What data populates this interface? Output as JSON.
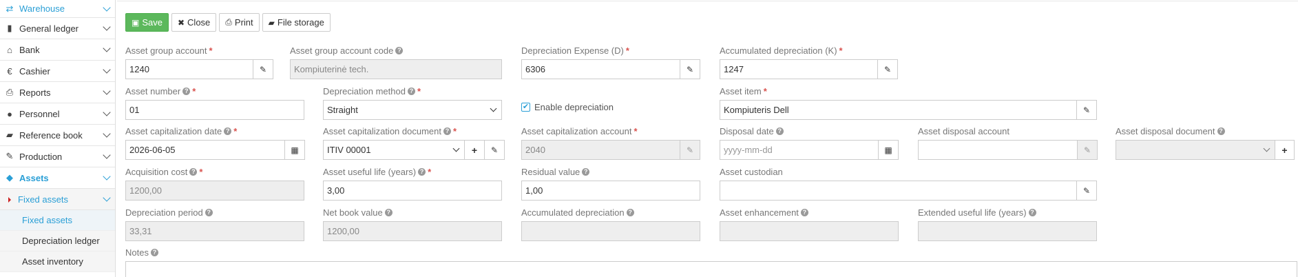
{
  "sidebar": {
    "items": [
      {
        "label": "Warehouse",
        "icon": "arrows-swap-icon"
      },
      {
        "label": "General ledger",
        "icon": "book-icon"
      },
      {
        "label": "Bank",
        "icon": "bank-icon"
      },
      {
        "label": "Cashier",
        "icon": "euro-icon"
      },
      {
        "label": "Reports",
        "icon": "printer-icon"
      },
      {
        "label": "Personnel",
        "icon": "users-icon"
      },
      {
        "label": "Reference book",
        "icon": "folder-open-icon"
      },
      {
        "label": "Production",
        "icon": "wrench-icon"
      },
      {
        "label": "Assets",
        "icon": "cube-icon"
      }
    ],
    "submenu": {
      "label": "Fixed assets"
    },
    "leaves": [
      {
        "label": "Fixed assets"
      },
      {
        "label": "Depreciation ledger"
      },
      {
        "label": "Asset inventory"
      }
    ]
  },
  "toolbar": {
    "save_label": "Save",
    "close_label": "Close",
    "print_label": "Print",
    "file_storage_label": "File storage"
  },
  "form": {
    "asset_group_account": {
      "label": "Asset group account",
      "value": "1240"
    },
    "asset_group_account_code": {
      "label": "Asset group account code",
      "value": "Kompiuterinė tech."
    },
    "depreciation_expense": {
      "label": "Depreciation Expense (D)",
      "value": "6306"
    },
    "accumulated_depreciation_k": {
      "label": "Accumulated depreciation (K)",
      "value": "1247"
    },
    "asset_number": {
      "label": "Asset number",
      "value": "01"
    },
    "depreciation_method": {
      "label": "Depreciation method",
      "value": "Straight"
    },
    "enable_depreciation": {
      "label": "Enable depreciation",
      "checked": true
    },
    "asset_item": {
      "label": "Asset item",
      "value": "Kompiuteris Dell"
    },
    "capitalization_date": {
      "label": "Asset capitalization date",
      "value": "2026-06-05"
    },
    "capitalization_document": {
      "label": "Asset capitalization document",
      "value": "ITIV 00001"
    },
    "capitalization_account": {
      "label": "Asset capitalization account",
      "value": "2040"
    },
    "disposal_date": {
      "label": "Disposal date",
      "placeholder": "yyyy-mm-dd"
    },
    "disposal_account": {
      "label": "Asset disposal account",
      "value": ""
    },
    "disposal_document": {
      "label": "Asset disposal document",
      "value": ""
    },
    "acquisition_cost": {
      "label": "Acquisition cost",
      "value": "1200,00"
    },
    "useful_life": {
      "label": "Asset useful life (years)",
      "value": "3,00"
    },
    "residual_value": {
      "label": "Residual value",
      "value": "1,00"
    },
    "asset_custodian": {
      "label": "Asset custodian",
      "value": ""
    },
    "depreciation_period": {
      "label": "Depreciation period",
      "value": "33,31"
    },
    "net_book_value": {
      "label": "Net book value",
      "value": "1200,00"
    },
    "accumulated_depreciation": {
      "label": "Accumulated depreciation",
      "value": ""
    },
    "asset_enhancement": {
      "label": "Asset enhancement",
      "value": ""
    },
    "extended_useful_life": {
      "label": "Extended useful life (years)",
      "value": ""
    },
    "notes": {
      "label": "Notes",
      "value": ""
    }
  },
  "colors": {
    "accent": "#2a9fd6",
    "save": "#5cb85c",
    "required": "#d9534f"
  }
}
